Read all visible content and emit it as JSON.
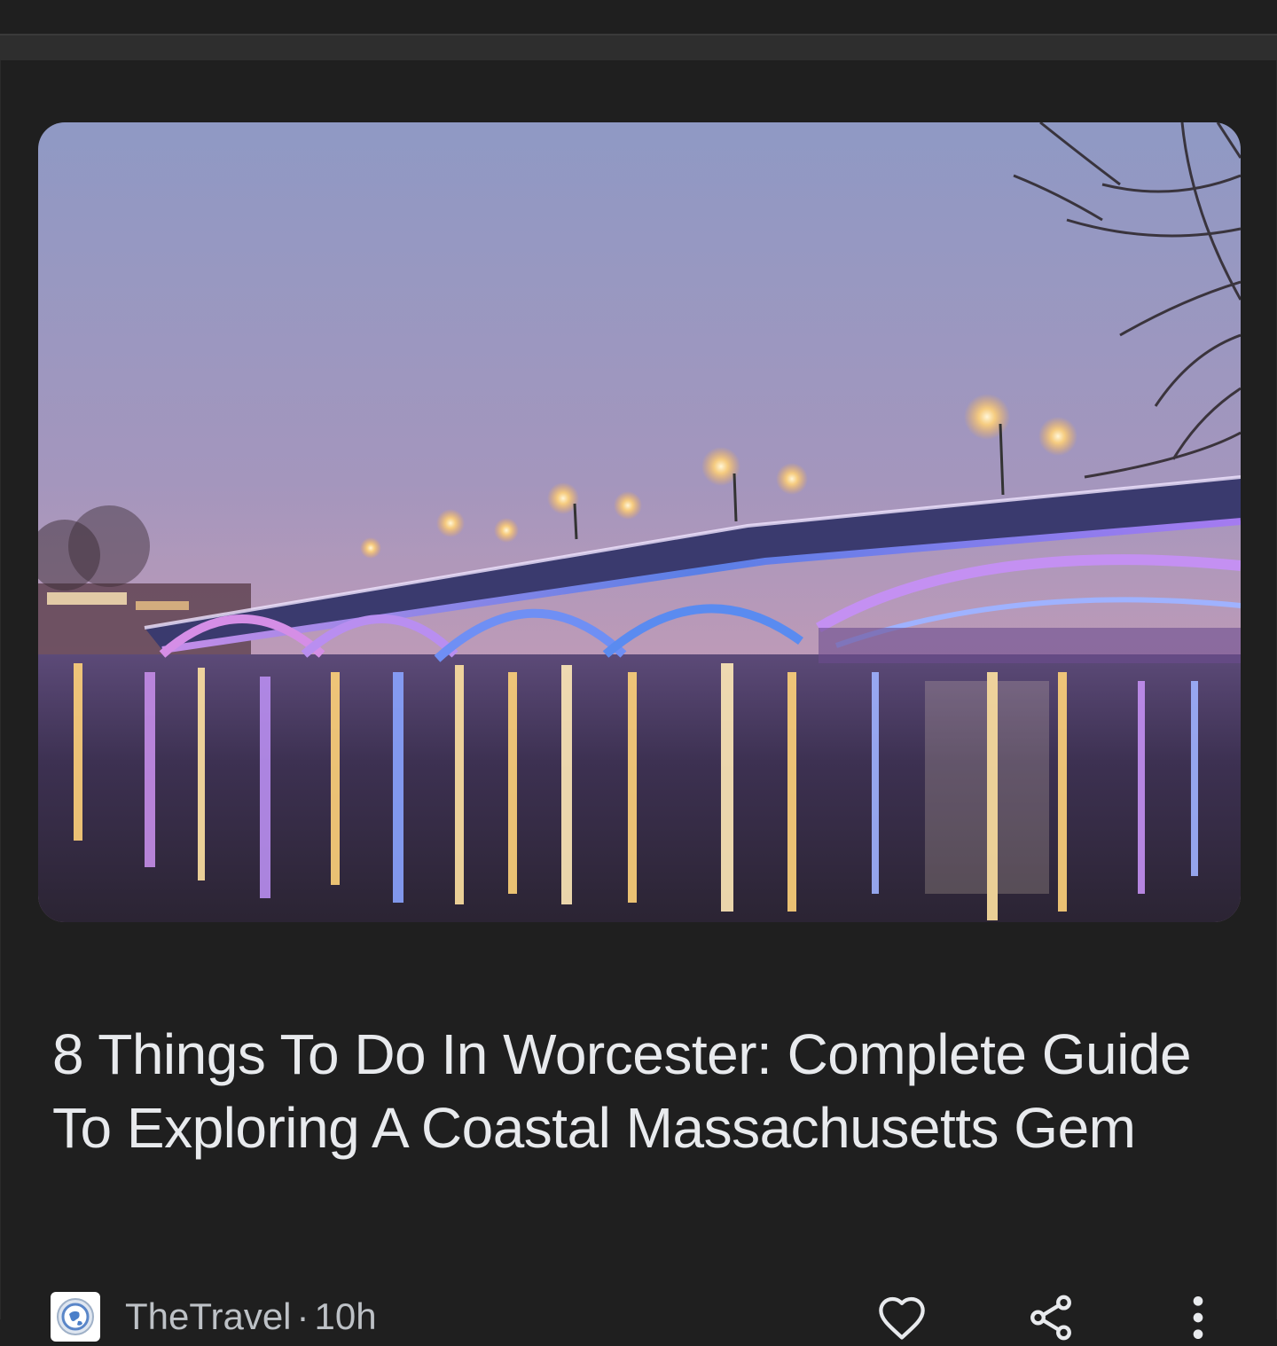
{
  "article": {
    "image_alt": "Illuminated bridge over water at dusk",
    "headline": "8 Things To Do In Worcester: Complete Guide To Exploring A Coastal Massachusetts Gem",
    "source": "TheTravel",
    "separator": "·",
    "age": "10h"
  },
  "actions": {
    "like_icon": "heart-outline-icon",
    "share_icon": "share-icon",
    "more_icon": "more-vert-icon"
  },
  "colors": {
    "background": "#1f1f1f",
    "headline_text": "#e8eaed",
    "meta_text": "#bdc1c6",
    "icon": "#e8eaed"
  }
}
